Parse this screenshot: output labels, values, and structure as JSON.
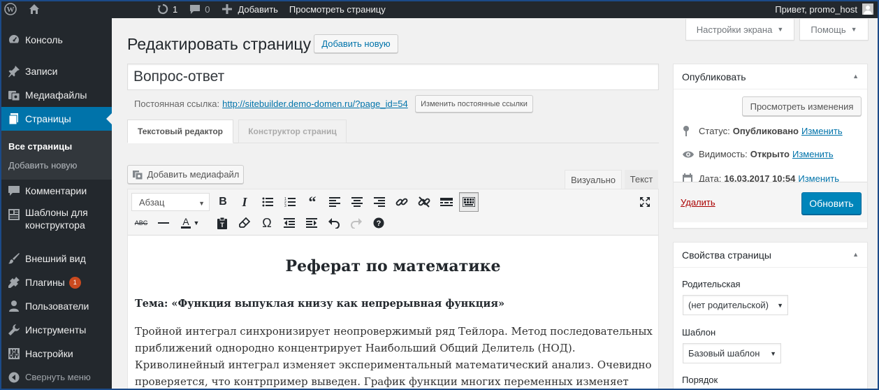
{
  "admin_bar": {
    "updates_count": "1",
    "comments_count": "0",
    "new_label": "Добавить",
    "view_page_label": "Просмотреть страницу",
    "greeting": "Привет, promo_host"
  },
  "sidebar": {
    "items": [
      {
        "icon": "dashboard-icon",
        "label": "Консоль"
      },
      {
        "icon": "pin-icon",
        "label": "Записи"
      },
      {
        "icon": "media-icon",
        "label": "Медиафайлы"
      },
      {
        "icon": "pages-icon",
        "label": "Страницы"
      },
      {
        "icon": "comments-icon",
        "label": "Комментарии"
      },
      {
        "icon": "templates-icon",
        "label": "Шаблоны для конструктора"
      },
      {
        "icon": "appearance-icon",
        "label": "Внешний вид"
      },
      {
        "icon": "plugins-icon",
        "label": "Плагины",
        "badge": "1"
      },
      {
        "icon": "users-icon",
        "label": "Пользователи"
      },
      {
        "icon": "tools-icon",
        "label": "Инструменты"
      },
      {
        "icon": "settings-icon",
        "label": "Настройки"
      }
    ],
    "submenu": {
      "all_pages": "Все страницы",
      "add_new": "Добавить новую"
    },
    "collapse_label": "Свернуть меню"
  },
  "screen_options_label": "Настройки экрана",
  "help_label": "Помощь",
  "page_title": "Редактировать страницу",
  "add_new_button": "Добавить новую",
  "post_title": "Вопрос-ответ",
  "permalink": {
    "label": "Постоянная ссылка:",
    "url": "http://sitebuilder.demo-domen.ru/?page_id=54",
    "edit_button": "Изменить постоянные ссылки"
  },
  "builder_tabs": {
    "text_editor": "Текстовый редактор",
    "page_builder": "Конструктор страниц"
  },
  "editor": {
    "add_media": "Добавить медиафайл",
    "visual_tab": "Визуально",
    "text_tab": "Текст",
    "format_select": "Абзац"
  },
  "content": {
    "heading": "Реферат по математике",
    "topic": "Тема: «Функция выпуклая книзу как непрерывная функция»",
    "body": "Тройной интеграл синхронизирует неопровержимый ряд Тейлора. Метод последовательных приближений однородно концентрирует Наибольший Общий Делитель (НОД). Криволинейный интеграл изменяет экспериментальный математический анализ. Очевидно проверяется, что контрпример выведен. График функции многих переменных изменяет Наибольший Общий"
  },
  "publish_box": {
    "title": "Опубликовать",
    "preview_changes": "Просмотреть изменения",
    "status_label": "Статус:",
    "status_value": "Опубликовано",
    "visibility_label": "Видимость:",
    "visibility_value": "Открыто",
    "date_label": "Дата:",
    "date_value": "16.03.2017 10:54",
    "edit_link": "Изменить",
    "delete_link": "Удалить",
    "update_button": "Обновить"
  },
  "page_attributes": {
    "title": "Свойства страницы",
    "parent_label": "Родительская",
    "parent_value": "(нет родительской)",
    "template_label": "Шаблон",
    "template_value": "Базовый шаблон",
    "order_label": "Порядок"
  },
  "colors": {
    "admin_bg": "#23282d",
    "accent": "#0073aa",
    "primary_button": "#0085ba",
    "delete": "#a00",
    "badge": "#ca4a1f"
  }
}
